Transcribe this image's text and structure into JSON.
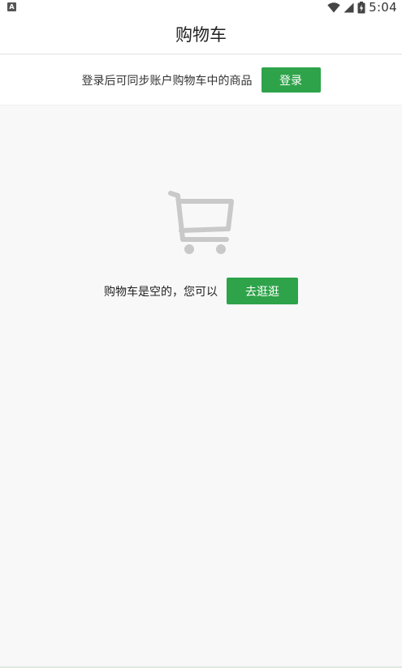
{
  "status_bar": {
    "notification_icon": "notification-a-icon",
    "notification_letter": "A",
    "icons": [
      "wifi-icon",
      "cellular-signal-icon",
      "battery-charging-icon"
    ],
    "time": "5:04"
  },
  "header": {
    "title": "购物车"
  },
  "login_banner": {
    "message": "登录后可同步账户购物车中的商品",
    "button_label": "登录"
  },
  "empty_state": {
    "icon": "shopping-cart-icon",
    "message": "购物车是空的，您可以",
    "button_label": "去逛逛"
  },
  "colors": {
    "accent": "#2ea34a",
    "background": "#f8f8f8",
    "icon_gray": "#c8c8c8"
  }
}
